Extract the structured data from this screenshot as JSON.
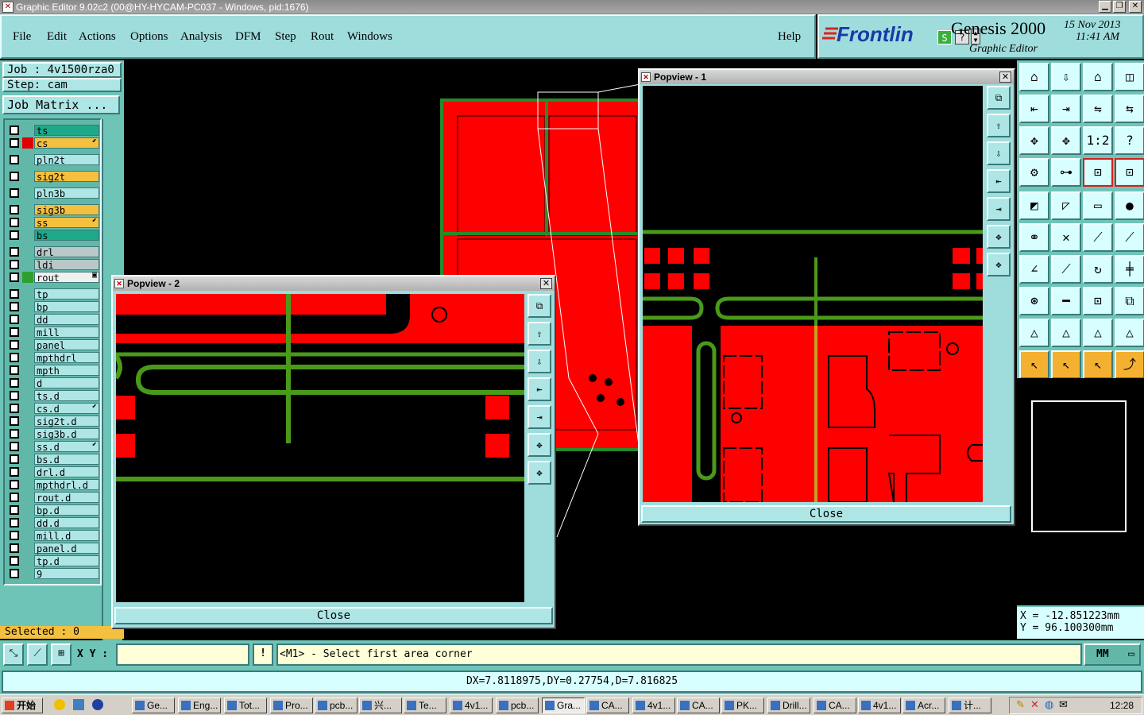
{
  "window": {
    "title": "Graphic Editor 9.02c2 (00@HY-HYCAM-PC037 - Windows, pid:1676)"
  },
  "menu": [
    "File",
    "Edit",
    "Actions",
    "Options",
    "Analysis",
    "DFM",
    "Step",
    "Rout",
    "Windows"
  ],
  "help": "Help",
  "brand": {
    "logo": "Frontlin",
    "product": "Genesis 2000",
    "sub": "Graphic Editor",
    "date": "15 Nov 2013",
    "time": "11:41 AM"
  },
  "job": {
    "job": "Job : 4v1500rza0",
    "step": "Step: cam",
    "matrix_btn": "Job Matrix ..."
  },
  "layers": [
    {
      "name": "ts",
      "style": "green"
    },
    {
      "name": "cs",
      "style": "orange",
      "swatch": "#e00000",
      "mark": "⬋"
    },
    {
      "name": "pln2t",
      "style": ""
    },
    {
      "name": "sig2t",
      "style": "orange"
    },
    {
      "name": "pln3b",
      "style": ""
    },
    {
      "name": "sig3b",
      "style": "orange"
    },
    {
      "name": "ss",
      "style": "orange",
      "mark": "⬋"
    },
    {
      "name": "bs",
      "style": "green"
    },
    {
      "name": "drl",
      "style": "grey"
    },
    {
      "name": "ldi",
      "style": "grey"
    },
    {
      "name": "rout",
      "style": "white",
      "swatch": "#2ea02e",
      "mark": "▣"
    },
    {
      "name": "tp",
      "style": ""
    },
    {
      "name": "bp",
      "style": ""
    },
    {
      "name": "dd",
      "style": ""
    },
    {
      "name": "mill",
      "style": ""
    },
    {
      "name": "panel",
      "style": ""
    },
    {
      "name": "mpthdrl",
      "style": ""
    },
    {
      "name": "mpth",
      "style": ""
    },
    {
      "name": "d",
      "style": ""
    },
    {
      "name": "ts.d",
      "style": ""
    },
    {
      "name": "cs.d",
      "style": "",
      "mark": "⬋"
    },
    {
      "name": "sig2t.d",
      "style": ""
    },
    {
      "name": "sig3b.d",
      "style": ""
    },
    {
      "name": "ss.d",
      "style": "",
      "mark": "⬋"
    },
    {
      "name": "bs.d",
      "style": ""
    },
    {
      "name": "drl.d",
      "style": ""
    },
    {
      "name": "mpthdrl.d",
      "style": ""
    },
    {
      "name": "rout.d",
      "style": ""
    },
    {
      "name": "bp.d",
      "style": ""
    },
    {
      "name": "dd.d",
      "style": ""
    },
    {
      "name": "mill.d",
      "style": ""
    },
    {
      "name": "panel.d",
      "style": ""
    },
    {
      "name": "tp.d",
      "style": ""
    },
    {
      "name": "9",
      "style": ""
    }
  ],
  "selected": "Selected : 0",
  "popview1": {
    "title": "Popview - 1",
    "close": "Close"
  },
  "popview2": {
    "title": "Popview - 2",
    "close": "Close"
  },
  "coords": {
    "x": "X = -12.851223mm",
    "y": "Y = 96.100300mm"
  },
  "status": {
    "xy_label": "X Y :",
    "xy_value": "",
    "prompt": "<M1> - Select first area corner",
    "units": "MM"
  },
  "measure": "DX=7.8118975,DY=0.27754,D=7.816825",
  "taskbar": {
    "start": "开始",
    "tasks": [
      "Ge...",
      "Eng...",
      "Tot...",
      "Pro...",
      "pcb...",
      "兴...",
      "Te...",
      "4v1...",
      "pcb...",
      "Gra...",
      "CA...",
      "4v1...",
      "CA...",
      "PK...",
      "Drill...",
      "CA...",
      "4v1...",
      "Acr...",
      "计..."
    ],
    "clock": "12:28"
  },
  "colors": {
    "copper": "#ff0000",
    "rout": "#4a9a1a",
    "panel_bg": "#9fdcdc",
    "canvas": "#000000"
  }
}
